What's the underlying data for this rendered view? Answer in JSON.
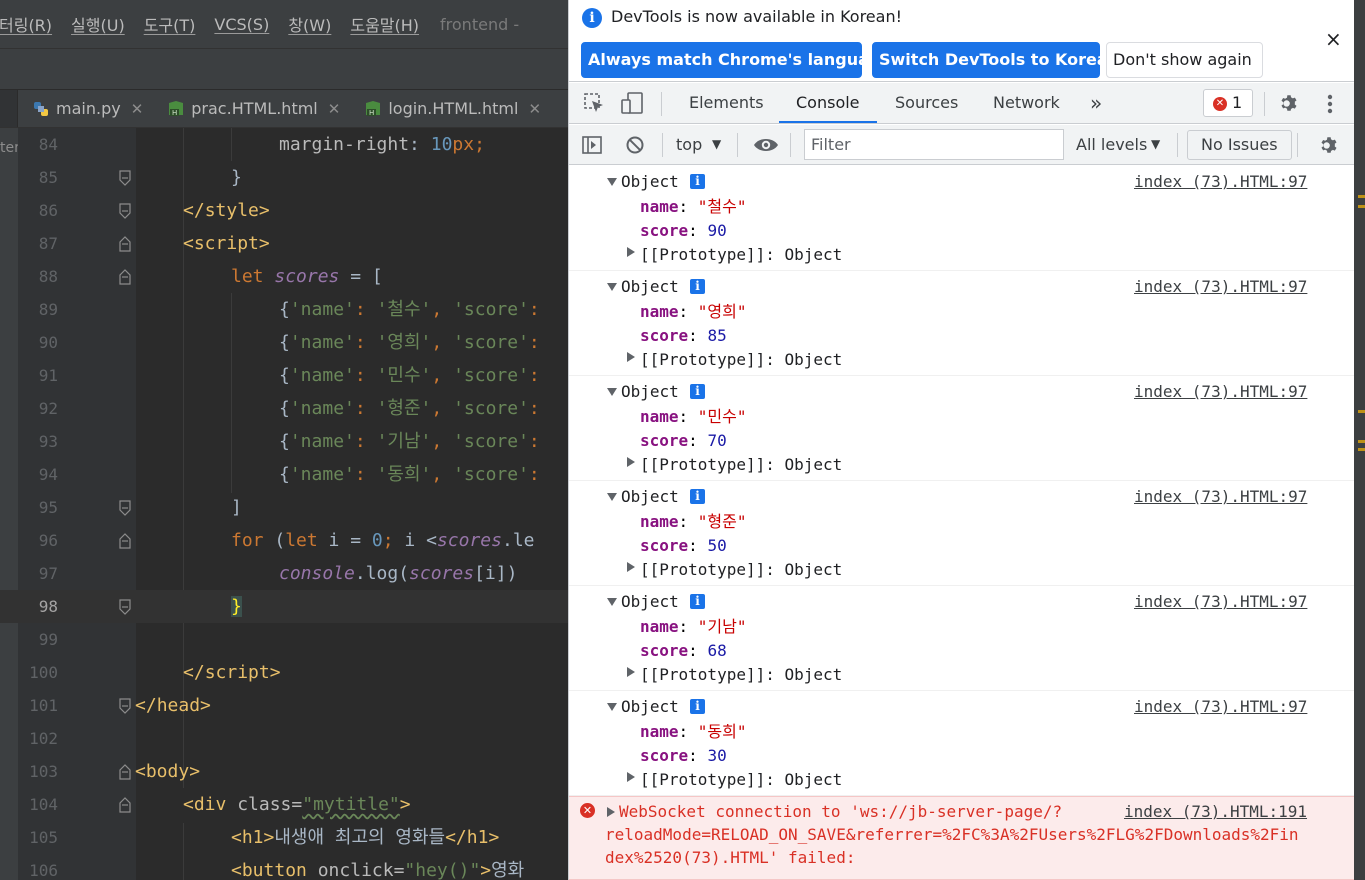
{
  "ide": {
    "menu": [
      {
        "label": "터링(R)"
      },
      {
        "label": "실행(U)"
      },
      {
        "label": "도구(T)"
      },
      {
        "label": "VCS(S)"
      },
      {
        "label": "창(W)"
      },
      {
        "label": "도움말(H)"
      }
    ],
    "project_name": "frontend -",
    "tabs": [
      {
        "label": "main.py",
        "icon": "python-file-icon"
      },
      {
        "label": "prac.HTML.html",
        "icon": "html-file-icon"
      },
      {
        "label": "login.HTML.html",
        "icon": "html-file-icon"
      }
    ],
    "side_strip_label": "ter",
    "current_line": "98",
    "lines": [
      {
        "n": "84"
      },
      {
        "n": "85"
      },
      {
        "n": "86"
      },
      {
        "n": "87"
      },
      {
        "n": "88"
      },
      {
        "n": "89"
      },
      {
        "n": "90"
      },
      {
        "n": "91"
      },
      {
        "n": "92"
      },
      {
        "n": "93"
      },
      {
        "n": "94"
      },
      {
        "n": "95"
      },
      {
        "n": "96"
      },
      {
        "n": "97"
      },
      {
        "n": "98"
      },
      {
        "n": "99"
      },
      {
        "n": "100"
      },
      {
        "n": "101"
      },
      {
        "n": "102"
      },
      {
        "n": "103"
      },
      {
        "n": "104"
      },
      {
        "n": "105"
      },
      {
        "n": "106"
      }
    ],
    "code": {
      "l84": {
        "prop": "margin-right",
        "num": "10",
        "unit": "px"
      },
      "l86": {
        "tag": "style"
      },
      "l87": {
        "tag": "script"
      },
      "l88": {
        "kw": "let",
        "var": "scores",
        "rest": " = ["
      },
      "students": [
        {
          "name": "철수"
        },
        {
          "name": "영희"
        },
        {
          "name": "민수"
        },
        {
          "name": "형준"
        },
        {
          "name": "기남"
        },
        {
          "name": "동희"
        }
      ],
      "key_name": "'name'",
      "key_score": "'score'",
      "l96": {
        "kw_for": "for",
        "kw_let": "let",
        "zero": "0",
        "var": "scores",
        "tail": ".le"
      },
      "l97": {
        "obj": "console",
        "fn": ".log(",
        "var": "scores",
        "idx": "[i])"
      },
      "l100": {
        "tag": "script"
      },
      "l101": {
        "tag": "head"
      },
      "l103": {
        "tag": "body"
      },
      "l104": {
        "tag": "div",
        "attr": "class",
        "val": "\"mytitle\""
      },
      "l105": {
        "tag": "h1",
        "text": "내생애 최고의 영화들"
      },
      "l106": {
        "tag": "button",
        "attr": "onclick",
        "val": "\"hey()\"",
        "text": "영화"
      }
    }
  },
  "devtools": {
    "infobar": {
      "message": "DevTools is now available in Korean!",
      "btn_match": "Always match Chrome's language",
      "btn_switch": "Switch DevTools to Korean",
      "btn_dismiss": "Don't show again",
      "close": "×"
    },
    "tabs": {
      "elements": "Elements",
      "console": "Console",
      "sources": "Sources",
      "network": "Network",
      "more": "»"
    },
    "error_count": "1",
    "toolbar": {
      "context": "top",
      "filter_placeholder": "Filter",
      "levels": "All levels",
      "issues": "No Issues"
    },
    "logs": [
      {
        "name": "\"철수\"",
        "score": "90"
      },
      {
        "name": "\"영희\"",
        "score": "85"
      },
      {
        "name": "\"민수\"",
        "score": "70"
      },
      {
        "name": "\"형준\"",
        "score": "50"
      },
      {
        "name": "\"기남\"",
        "score": "68"
      },
      {
        "name": "\"동희\"",
        "score": "30"
      }
    ],
    "log_labels": {
      "object": "Object",
      "name_key": "name",
      "score_key": "score",
      "proto": "[[Prototype]]: Object",
      "source": "index (73).HTML:97"
    },
    "error": {
      "line1": "WebSocket connection to 'ws://jb-server-page/?",
      "line2": "reloadMode=RELOAD_ON_SAVE&referrer=%2FC%3A%2FUsers%2FLG%2FDownloads%2Fin",
      "line3": "dex%2520(73).HTML' failed:",
      "source": "index (73).HTML:191"
    }
  },
  "colors": {
    "ide_bg": "#2b2b2b",
    "accent_blue": "#1a73e8",
    "error_red": "#d93025"
  }
}
